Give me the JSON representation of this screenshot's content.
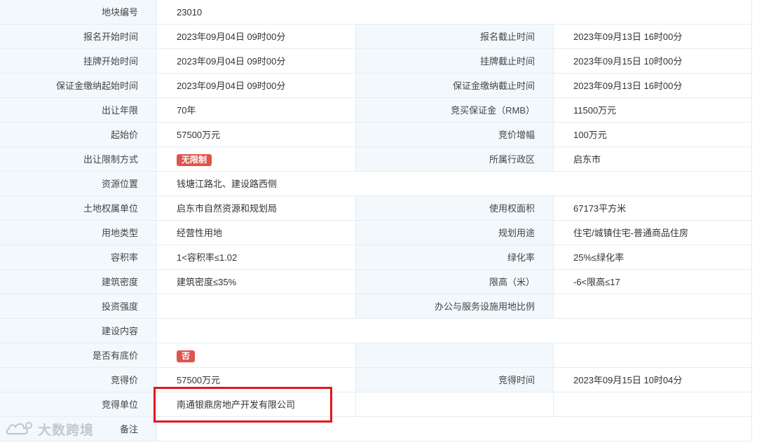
{
  "rows": [
    {
      "l1": "地块编号",
      "v1": "23010"
    },
    {
      "l1": "报名开始时间",
      "v1": "2023年09月04日 09时00分",
      "l2": "报名截止时间",
      "v2": "2023年09月13日 16时00分"
    },
    {
      "l1": "挂牌开始时间",
      "v1": "2023年09月04日 09时00分",
      "l2": "挂牌截止时间",
      "v2": "2023年09月15日 10时00分"
    },
    {
      "l1": "保证金缴纳起始时间",
      "v1": "2023年09月04日 09时00分",
      "l2": "保证金缴纳截止时间",
      "v2": "2023年09月13日 16时00分"
    },
    {
      "l1": "出让年限",
      "v1": "70年",
      "l2": "竞买保证金（RMB）",
      "v2": "11500万元"
    },
    {
      "l1": "起始价",
      "v1": "57500万元",
      "l2": "竞价增幅",
      "v2": "100万元"
    },
    {
      "l1": "出让限制方式",
      "badge": "无限制",
      "l2": "所属行政区",
      "v2": "启东市"
    },
    {
      "l1": "资源位置",
      "v1": "钱塘江路北、建设路西侧"
    },
    {
      "l1": "土地权属单位",
      "v1": "启东市自然资源和规划局",
      "l2": "使用权面积",
      "v2": "67173平方米"
    },
    {
      "l1": "用地类型",
      "v1": "经营性用地",
      "l2": "规划用途",
      "v2": "住宅/城镇住宅-普通商品住房"
    },
    {
      "l1": "容积率",
      "v1": "1<容积率≤1.02",
      "l2": "绿化率",
      "v2": "25%≤绿化率"
    },
    {
      "l1": "建筑密度",
      "v1": "建筑密度≤35%",
      "l2": "限高（米）",
      "v2": "-6<限高≤17"
    },
    {
      "l1": "投资强度",
      "v1": "",
      "l2": "办公与服务设施用地比例",
      "v2": ""
    },
    {
      "l1": "建设内容",
      "v1": ""
    },
    {
      "l1": "是否有底价",
      "badge": "否",
      "l2": "",
      "v2": ""
    },
    {
      "l1": "竞得价",
      "v1": "57500万元",
      "l2": "竞得时间",
      "v2": "2023年09月15日 10时04分"
    },
    {
      "l1": "竞得单位",
      "v1": "南通银鼎房地产开发有限公司",
      "l2": "",
      "v2": ""
    },
    {
      "l1": "备注",
      "v1": ""
    }
  ],
  "watermark": {
    "text": "大数跨境",
    "logo_icon": "cloud-logo-icon"
  },
  "colors": {
    "label_bg": "#f2f8fc",
    "badge_bg": "#e0534b",
    "highlight": "#e8141a"
  }
}
